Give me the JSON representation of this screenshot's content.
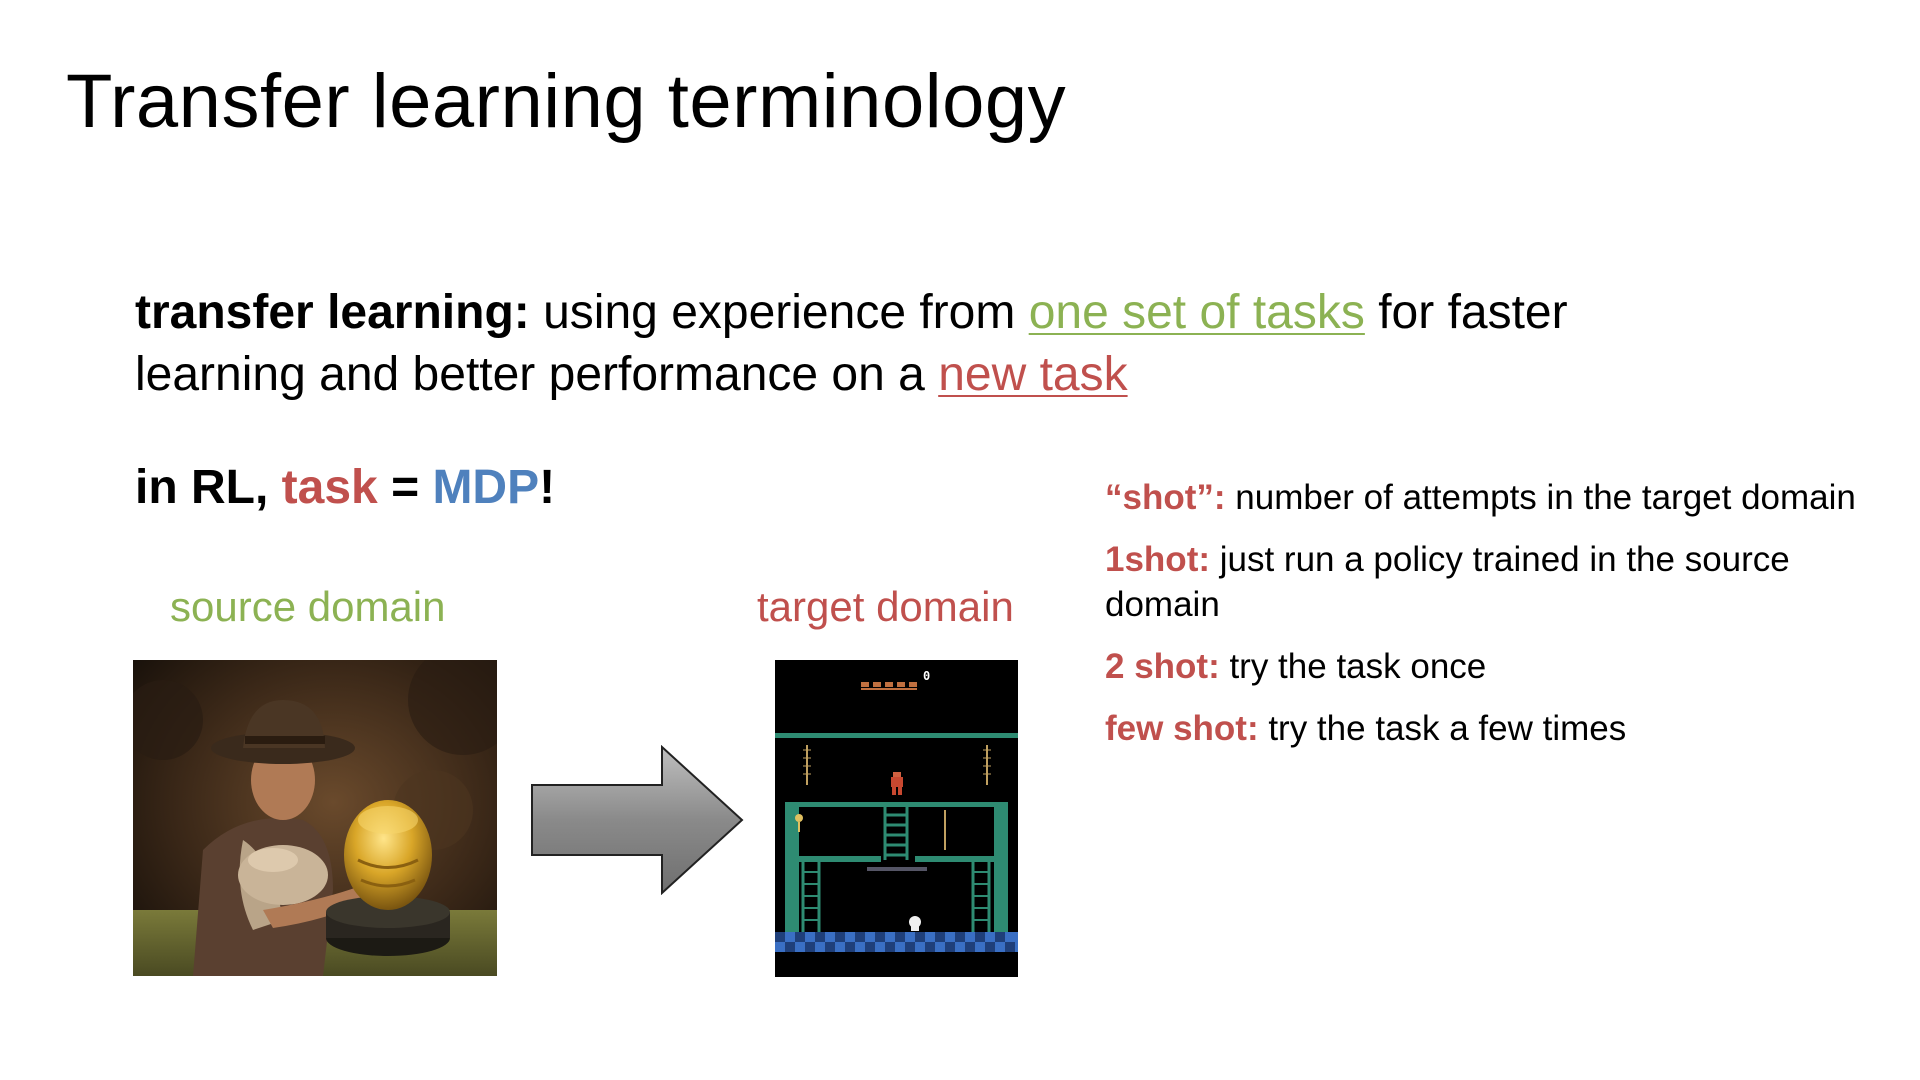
{
  "slide": {
    "title": "Transfer learning terminology",
    "definition": {
      "term": "transfer learning:",
      "text_1": " using experience from ",
      "highlight_1": "one set of tasks",
      "text_2": " for faster learning and better performance on a ",
      "highlight_2": "new task"
    },
    "rl_line": {
      "prefix": "in RL, ",
      "task": "task",
      "equals": " = ",
      "mdp": "MDP",
      "suffix": "!"
    },
    "source_label": "source domain",
    "target_label": "target domain",
    "notes": [
      {
        "term": "“shot”:",
        "text": " number of attempts in the target domain"
      },
      {
        "term": "1shot:",
        "text": " just run a policy trained in the source domain"
      },
      {
        "term": "2 shot:",
        "text": " try the task once"
      },
      {
        "term": "few shot:",
        "text": " try the task a few times"
      }
    ],
    "game_score": "0"
  },
  "colors": {
    "green": "#8CB253",
    "red": "#C0504D",
    "blue": "#4F81BD",
    "arrow_fill": "#8A8A8A",
    "game_teal": "#2E8B72",
    "game_blue_floor": "#3A6FC4"
  },
  "icons": {
    "arrow": "right-arrow-icon",
    "source": "indiana-jones-photo",
    "target": "montezumas-revenge-game-screen"
  }
}
